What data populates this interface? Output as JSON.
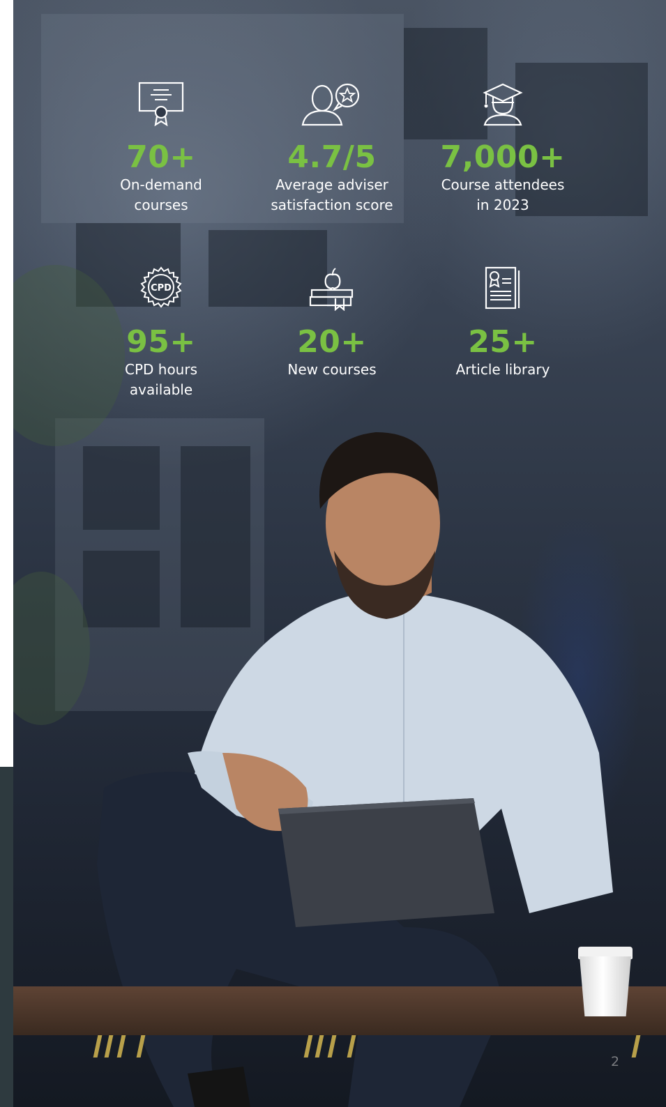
{
  "stats": [
    {
      "icon": "certificate-icon",
      "value": "70+",
      "label_line1": "On-demand",
      "label_line2": "courses"
    },
    {
      "icon": "adviser-rating-icon",
      "value": "4.7/5",
      "label_line1": "Average adviser",
      "label_line2": "satisfaction score"
    },
    {
      "icon": "graduate-icon",
      "value": "7,000+",
      "label_line1": "Course attendees",
      "label_line2": "in 2023"
    },
    {
      "icon": "cpd-badge-icon",
      "value": "95+",
      "label_line1": "CPD hours",
      "label_line2": "available"
    },
    {
      "icon": "books-apple-icon",
      "value": "20+",
      "label_line1": "New courses",
      "label_line2": ""
    },
    {
      "icon": "document-badge-icon",
      "value": "25+",
      "label_line1": "Article library",
      "label_line2": ""
    }
  ],
  "cpd_badge_text": "CPD",
  "page_number": "2",
  "colors": {
    "accent": "#7ac143",
    "text": "#ffffff"
  }
}
